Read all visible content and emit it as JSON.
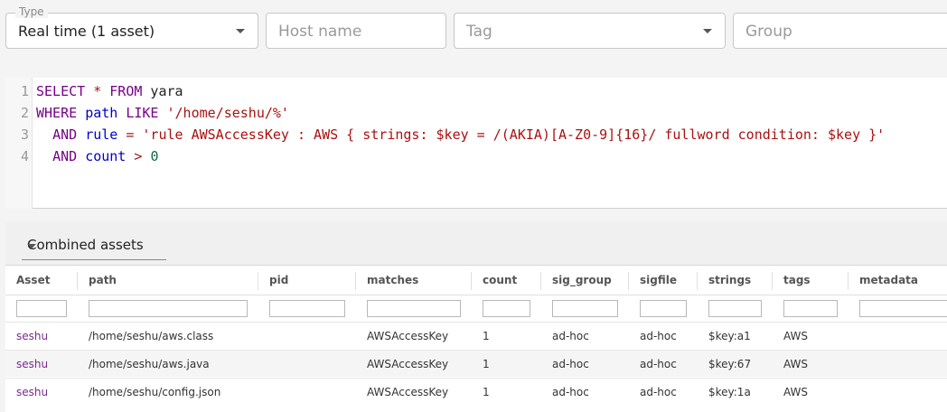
{
  "filters": {
    "type": {
      "legend": "Type",
      "value": "Real time (1 asset)"
    },
    "host": {
      "placeholder": "Host name"
    },
    "tag": {
      "placeholder": "Tag"
    },
    "group": {
      "placeholder": "Group"
    }
  },
  "editor": {
    "line_numbers": [
      "1",
      "2",
      "3",
      "4"
    ],
    "lines": [
      [
        {
          "t": "kw",
          "v": "SELECT"
        },
        {
          "t": "op",
          "v": " * "
        },
        {
          "t": "kw",
          "v": "FROM"
        },
        {
          "t": "plain",
          "v": " yara"
        }
      ],
      [
        {
          "t": "kw",
          "v": "WHERE"
        },
        {
          "t": "plain",
          "v": " "
        },
        {
          "t": "var",
          "v": "path"
        },
        {
          "t": "plain",
          "v": " "
        },
        {
          "t": "kw",
          "v": "LIKE"
        },
        {
          "t": "plain",
          "v": " "
        },
        {
          "t": "str",
          "v": "'/home/seshu/%'"
        }
      ],
      [
        {
          "t": "plain",
          "v": "  "
        },
        {
          "t": "kw",
          "v": "AND"
        },
        {
          "t": "plain",
          "v": " "
        },
        {
          "t": "var",
          "v": "rule"
        },
        {
          "t": "op",
          "v": " = "
        },
        {
          "t": "str",
          "v": "'rule AWSAccessKey : AWS { strings: $key = /(AKIA)[A-Z0-9]{16}/ fullword condition: $key }'"
        }
      ],
      [
        {
          "t": "plain",
          "v": "  "
        },
        {
          "t": "kw",
          "v": "AND"
        },
        {
          "t": "plain",
          "v": " "
        },
        {
          "t": "var",
          "v": "count"
        },
        {
          "t": "op",
          "v": " > "
        },
        {
          "t": "num",
          "v": "0"
        }
      ]
    ]
  },
  "results": {
    "view_selector": "Combined assets",
    "columns": [
      "Asset",
      "path",
      "pid",
      "matches",
      "count",
      "sig_group",
      "sigfile",
      "strings",
      "tags",
      "metadata"
    ],
    "rows": [
      {
        "asset": "seshu",
        "path": "/home/seshu/aws.class",
        "pid": "",
        "matches": "AWSAccessKey",
        "count": "1",
        "sig_group": "ad-hoc",
        "sigfile": "ad-hoc",
        "strings": "$key:a1",
        "tags": "AWS",
        "metadata": ""
      },
      {
        "asset": "seshu",
        "path": "/home/seshu/aws.java",
        "pid": "",
        "matches": "AWSAccessKey",
        "count": "1",
        "sig_group": "ad-hoc",
        "sigfile": "ad-hoc",
        "strings": "$key:67",
        "tags": "AWS",
        "metadata": ""
      },
      {
        "asset": "seshu",
        "path": "/home/seshu/config.json",
        "pid": "",
        "matches": "AWSAccessKey",
        "count": "1",
        "sig_group": "ad-hoc",
        "sigfile": "ad-hoc",
        "strings": "$key:1a",
        "tags": "AWS",
        "metadata": ""
      }
    ]
  },
  "colors": {
    "keyword": "#770088",
    "string": "#aa1111",
    "number": "#116644",
    "asset_link": "#7a2a8a"
  }
}
